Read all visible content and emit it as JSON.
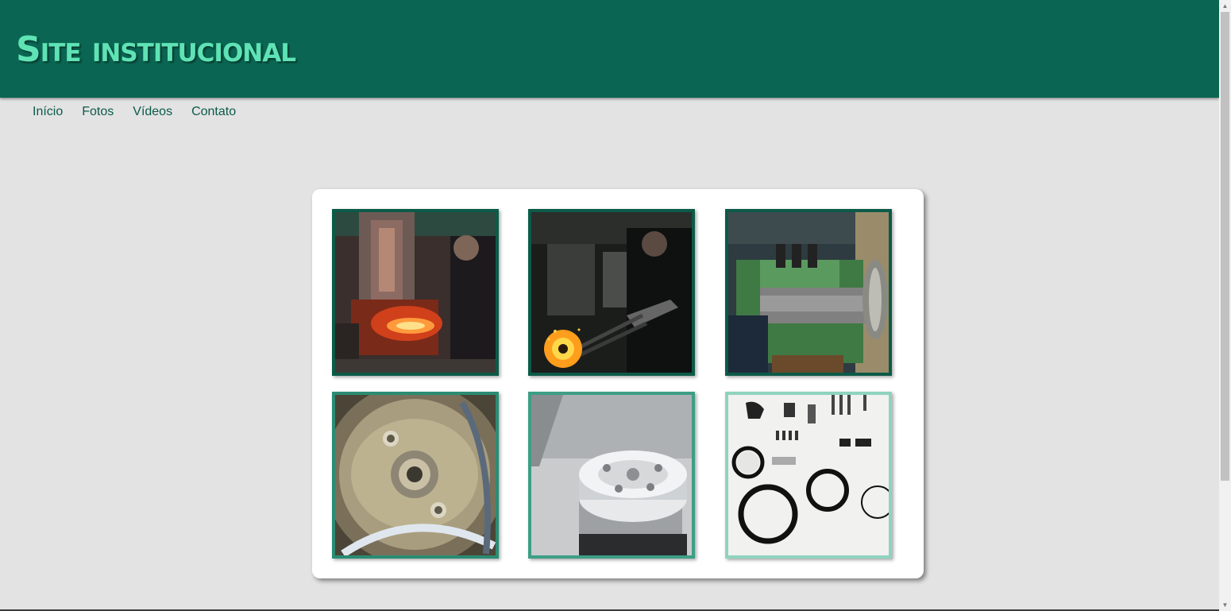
{
  "header": {
    "title": "Site institucional",
    "background": "#0a6652",
    "title_color": "#5fe3b5"
  },
  "nav": {
    "items": [
      {
        "label": "Início"
      },
      {
        "label": "Fotos"
      },
      {
        "label": "Vídeos"
      },
      {
        "label": "Contato"
      }
    ],
    "link_color": "#0b5a49"
  },
  "gallery": {
    "photos": [
      {
        "subject": "forging-hot-metal-photo"
      },
      {
        "subject": "glowing-ring-tongs-photo"
      },
      {
        "subject": "lathe-machining-photo"
      },
      {
        "subject": "metal-bearing-closeup-photo"
      },
      {
        "subject": "hard-drive-spindle-photo"
      },
      {
        "subject": "rings-and-small-parts-photo"
      }
    ]
  },
  "page": {
    "background": "#e3e3e3"
  }
}
